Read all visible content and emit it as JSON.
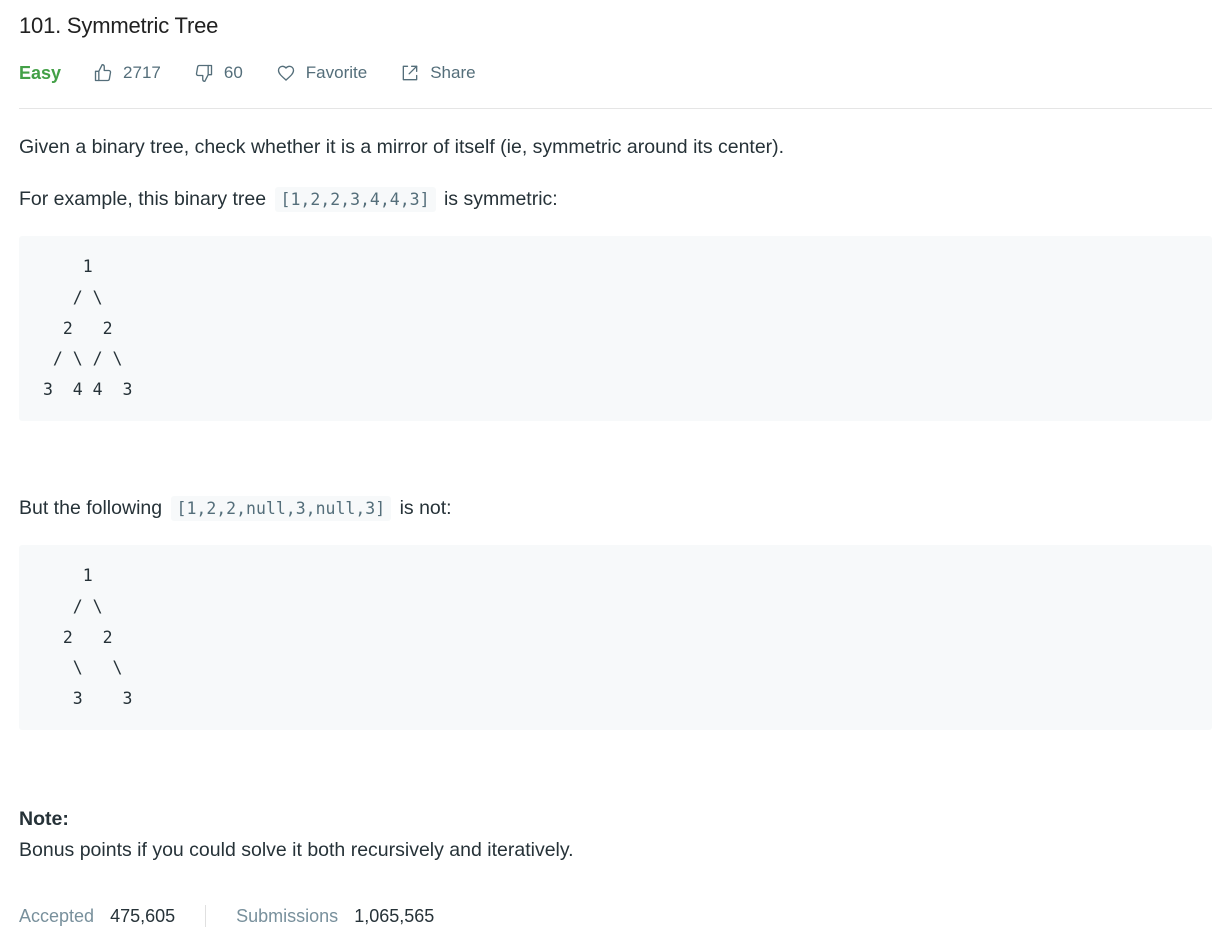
{
  "problem": {
    "title": "101. Symmetric Tree",
    "difficulty": "Easy",
    "likes": "2717",
    "dislikes": "60",
    "favorite_label": "Favorite",
    "share_label": "Share",
    "difficulty_color": "#43a047"
  },
  "description": {
    "intro": "Given a binary tree, check whether it is a mirror of itself (ie, symmetric around its center).",
    "example1": {
      "prefix": "For example, this binary tree",
      "code": "[1,2,2,3,4,4,3]",
      "suffix": "is symmetric:",
      "tree": "    1\n   / \\\n  2   2\n / \\ / \\\n3  4 4  3"
    },
    "example2": {
      "prefix": "But the following",
      "code": "[1,2,2,null,3,null,3]",
      "suffix": "is not:",
      "tree": "    1\n   / \\\n  2   2\n   \\   \\\n   3    3"
    },
    "note_label": "Note:",
    "note_text": "Bonus points if you could solve it both recursively and iteratively."
  },
  "stats": {
    "accepted_label": "Accepted",
    "accepted_value": "475,605",
    "submissions_label": "Submissions",
    "submissions_value": "1,065,565"
  },
  "icons": {
    "like": "thumbs-up-icon",
    "dislike": "thumbs-down-icon",
    "favorite": "heart-icon",
    "share": "share-icon"
  }
}
